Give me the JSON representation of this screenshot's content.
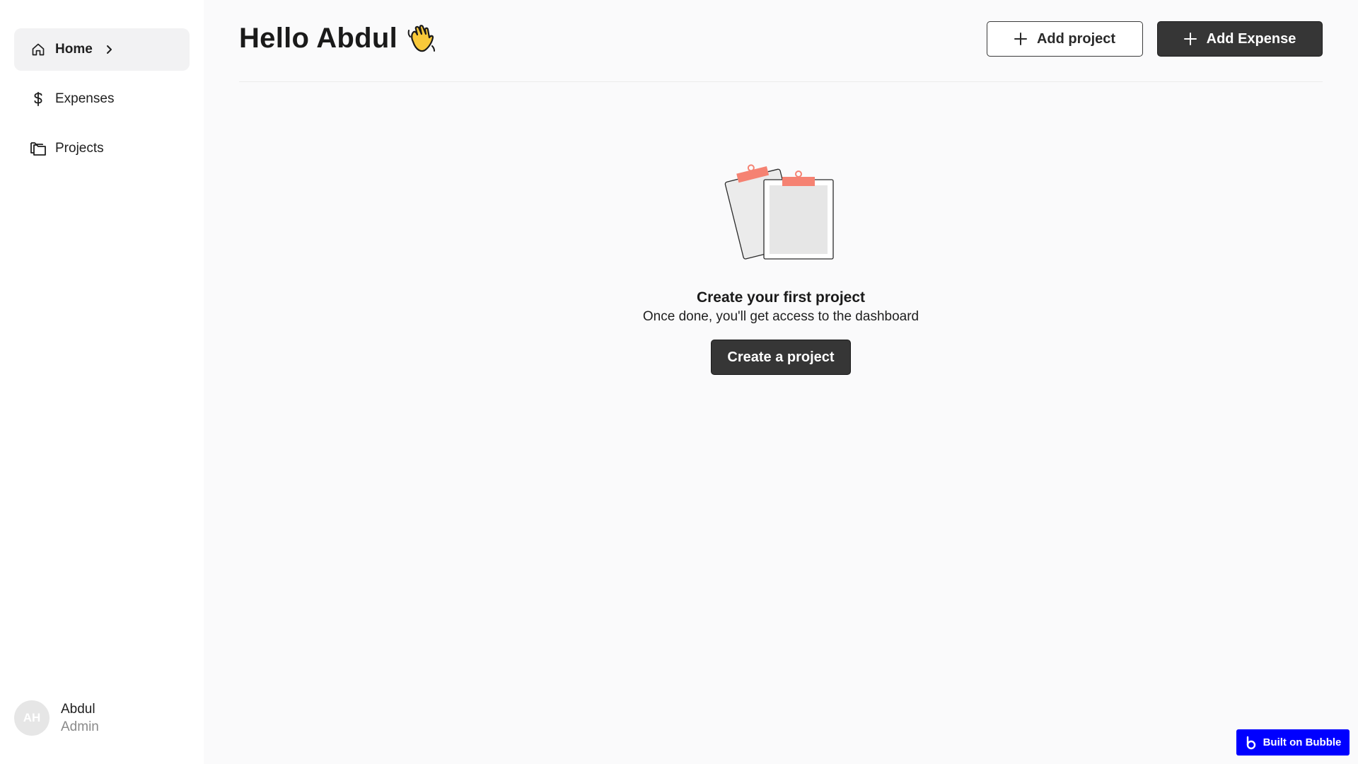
{
  "sidebar": {
    "items": [
      {
        "label": "Home",
        "icon": "home-icon",
        "active": true
      },
      {
        "label": "Expenses",
        "icon": "dollar-icon",
        "active": false
      },
      {
        "label": "Projects",
        "icon": "folders-icon",
        "active": false
      }
    ],
    "user": {
      "initials": "AH",
      "name": "Abdul",
      "role": "Admin"
    }
  },
  "header": {
    "greeting": "Hello Abdul",
    "emoji": "waving-hand-icon",
    "add_project_label": "Add project",
    "add_expense_label": "Add Expense"
  },
  "empty_state": {
    "illustration": "clipboards-illustration",
    "title": "Create your first project",
    "subtitle": "Once done, you'll get access to the dashboard",
    "button_label": "Create a project"
  },
  "badge": {
    "label": "Built on Bubble",
    "color": "#0000ff"
  },
  "colors": {
    "accent_dark": "#363636",
    "clip": "#f58272",
    "sidebar_active": "#f2f2f3"
  }
}
